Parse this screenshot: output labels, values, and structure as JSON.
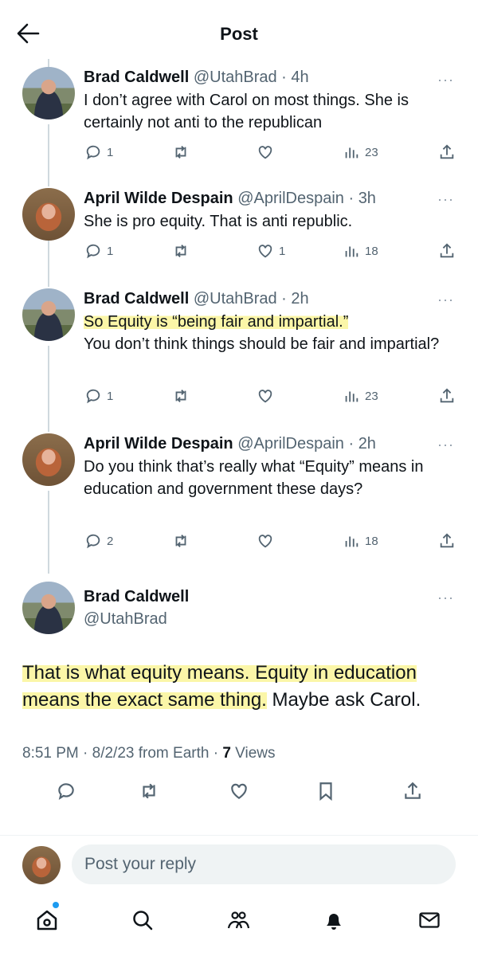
{
  "header": {
    "title": "Post"
  },
  "replies": [
    {
      "name": "Brad Caldwell",
      "handle": "@UtahBrad",
      "time": "4h",
      "text": "I don’t agree with Carol on most things. She is certainly not anti to the republican",
      "replies": "1",
      "reposts": "",
      "likes": "",
      "views": "23"
    },
    {
      "name": "April Wilde Despain",
      "handle": "@AprilDespain",
      "time": "3h",
      "text": "She is pro equity. That is anti republic.",
      "replies": "1",
      "reposts": "",
      "likes": "1",
      "views": "18"
    },
    {
      "name": "Brad Caldwell",
      "handle": "@UtahBrad",
      "time": "2h",
      "text_highlight": "So Equity is “being fair and impartial.”",
      "text_rest": "You don’t think things should be fair and impartial?",
      "replies": "1",
      "reposts": "",
      "likes": "",
      "views": "23"
    },
    {
      "name": "April Wilde Despain",
      "handle": "@AprilDespain",
      "time": "2h",
      "text": "Do you think that’s really what “Equity” means in education and government these days?",
      "replies": "2",
      "reposts": "",
      "likes": "",
      "views": "18"
    }
  ],
  "main_post": {
    "name": "Brad Caldwell",
    "handle": "@UtahBrad",
    "text_highlight": "That is what equity means. Equity in education means the exact same thing.",
    "text_rest": " Maybe ask Carol.",
    "timestamp": "8:51 PM · 8/2/23 from Earth · ",
    "views_count": "7",
    "views_label": " Views"
  },
  "reply_box": {
    "placeholder": "Post your reply"
  },
  "icons": {
    "back": "arrow-left-icon",
    "reply": "comment-icon",
    "repost": "repost-icon",
    "like": "heart-icon",
    "views": "views-icon",
    "share": "share-icon",
    "bookmark": "bookmark-icon",
    "home": "home-icon",
    "search": "search-icon",
    "communities": "people-icon",
    "notifications": "bell-icon",
    "messages": "mail-icon",
    "more": "ellipsis-icon"
  },
  "colors": {
    "text": "#0f1419",
    "muted": "#536471",
    "highlight": "#fbf6a8",
    "accent": "#1d9bf0"
  }
}
